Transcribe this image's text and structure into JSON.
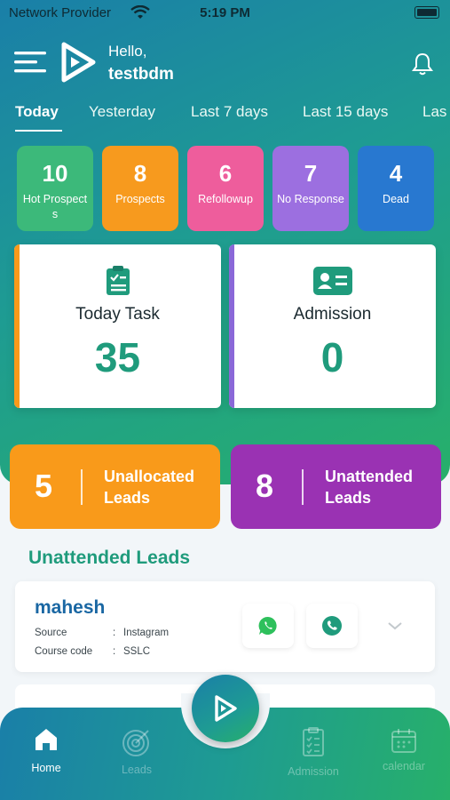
{
  "status_bar": {
    "carrier": "Network Provider",
    "time": "5:19 PM"
  },
  "header": {
    "greeting": "Hello,",
    "username": "testbdm"
  },
  "tabs": [
    {
      "label": "Today",
      "active": true
    },
    {
      "label": "Yesterday"
    },
    {
      "label": "Last 7 days"
    },
    {
      "label": "Last 15 days"
    },
    {
      "label": "Las"
    }
  ],
  "stats": [
    {
      "value": "10",
      "label": "Hot Prospects",
      "color": "#3cb97a"
    },
    {
      "value": "8",
      "label": "Prospects",
      "color": "#f79a1e"
    },
    {
      "value": "6",
      "label": "Refollowup",
      "color": "#ee5d9c"
    },
    {
      "value": "7",
      "label": "No Response",
      "color": "#9c6fe0"
    },
    {
      "value": "4",
      "label": "Dead",
      "color": "#2878d0"
    }
  ],
  "cards": {
    "today_task": {
      "title": "Today Task",
      "value": "35"
    },
    "admission": {
      "title": "Admission",
      "value": "0"
    }
  },
  "lead_boxes": {
    "unallocated": {
      "value": "5",
      "label": "Unallocated Leads"
    },
    "unattended": {
      "value": "8",
      "label": "Unattended Leads"
    }
  },
  "section_title": "Unattended Leads",
  "leads": [
    {
      "name": "mahesh",
      "source_key": "Source",
      "source_value": "Instagram",
      "course_key": "Course code",
      "course_value": "SSLC"
    }
  ],
  "nav": [
    {
      "label": "Home",
      "icon": "home-icon",
      "active": true
    },
    {
      "label": "Leads",
      "icon": "target-icon"
    },
    {
      "label": "Admission",
      "icon": "clipboard-icon"
    },
    {
      "label": "calendar",
      "icon": "calendar-icon"
    }
  ],
  "colors": {
    "primary": "#1f9b7c",
    "orange": "#f99a1a",
    "purple": "#9a32b3",
    "name_blue": "#1a67a3"
  }
}
